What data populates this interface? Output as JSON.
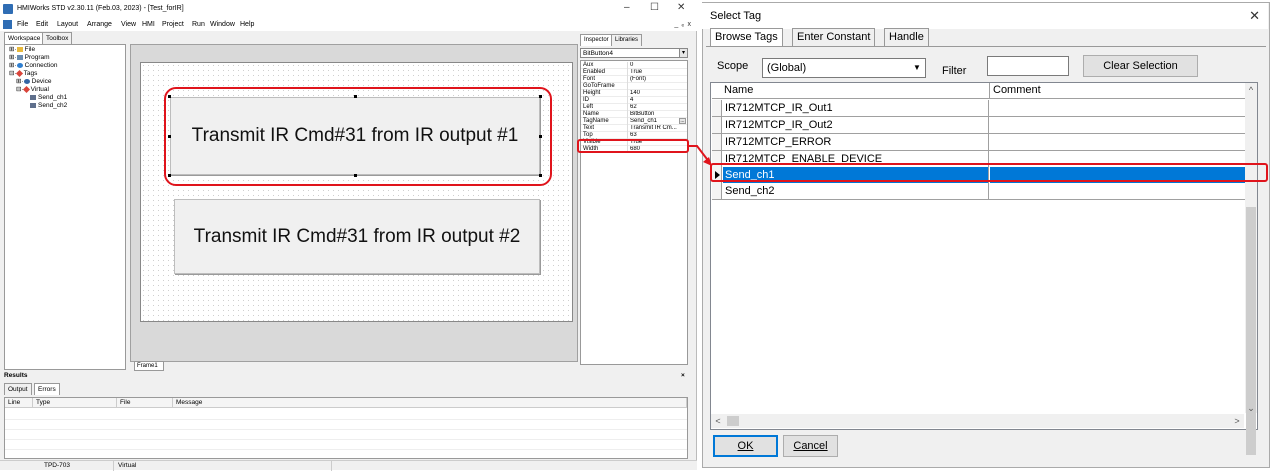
{
  "hmi": {
    "title": "HMIWorks STD v2.30.11 (Feb.03, 2023) - [Test_forIR]",
    "window_controls": [
      "–",
      "☐",
      "✕"
    ],
    "mdi_controls": "_  ₑ  x",
    "menu": [
      "File",
      "Edit",
      "Layout",
      "Arrange",
      "View",
      "HMI",
      "Project",
      "Run",
      "Window",
      "Help"
    ],
    "workspace_tabs": [
      "Workspace",
      "Toolbox"
    ],
    "tree": [
      {
        "label": "File",
        "prefix": "⊞·",
        "icon": "folder-icon",
        "color": "#e8b93c"
      },
      {
        "label": "Program",
        "prefix": "⊞·",
        "icon": "program-icon",
        "color": "#6a8caf"
      },
      {
        "label": "Connection",
        "prefix": "⊞·",
        "icon": "connection-icon",
        "color": "#2f7fd0"
      },
      {
        "label": "Tags",
        "prefix": "⊟·",
        "icon": "tags-icon",
        "color": "#d9443a"
      },
      {
        "label": "Device",
        "prefix": "⊞·",
        "icon": "device-icon",
        "color": "#3465a4"
      },
      {
        "label": "Virtual",
        "prefix": "⊟·",
        "icon": "virtual-icon",
        "color": "#d9443a"
      },
      {
        "label": "Send_ch1",
        "prefix": "",
        "icon": "tag-icon",
        "color": "#5f6f8c"
      },
      {
        "label": "Send_ch2",
        "prefix": "",
        "icon": "tag-icon",
        "color": "#5f6f8c"
      }
    ],
    "buttons": [
      {
        "text": "Transmit IR Cmd#31 from IR output #1"
      },
      {
        "text": "Transmit IR Cmd#31 from IR output #2"
      }
    ],
    "frame_tab": "Frame1",
    "inspector": {
      "tabs": [
        "Inspector",
        "Libraries"
      ],
      "selected_object": "BitButton4",
      "properties": [
        {
          "key": "Aux",
          "value": "0"
        },
        {
          "key": "Enabled",
          "value": "True"
        },
        {
          "key": "Font",
          "value": "(Font)"
        },
        {
          "key": "GoToFrame",
          "value": ""
        },
        {
          "key": "Height",
          "value": "140"
        },
        {
          "key": "ID",
          "value": "4"
        },
        {
          "key": "Left",
          "value": "62"
        },
        {
          "key": "Name",
          "value": "BitButton"
        },
        {
          "key": "TagName",
          "value": "Send_ch1"
        },
        {
          "key": "Text",
          "value": "Transmit IR Cm..."
        },
        {
          "key": "Top",
          "value": "63"
        },
        {
          "key": "Visible",
          "value": "True"
        },
        {
          "key": "Width",
          "value": "680"
        }
      ]
    },
    "results": {
      "title": "Results",
      "close": "×",
      "tabs": [
        "Output",
        "Errors"
      ],
      "columns": [
        "Line",
        "Type",
        "File",
        "Message"
      ]
    },
    "status": [
      "TPD-703",
      "Virtual"
    ]
  },
  "dialog": {
    "title": "Select Tag",
    "close": "✕",
    "tabs": [
      "Browse Tags",
      "Enter Constant",
      "Handle"
    ],
    "scope_label": "Scope",
    "scope_value": "(Global)",
    "filter_label": "Filter",
    "filter_value": "",
    "clear_label": "Clear Selection",
    "columns": [
      "Name",
      "Comment"
    ],
    "rows": [
      {
        "name": "IR712MTCP_IR_Out1",
        "comment": ""
      },
      {
        "name": "IR712MTCP_IR_Out2",
        "comment": ""
      },
      {
        "name": "IR712MTCP_ERROR",
        "comment": ""
      },
      {
        "name": "IR712MTCP_ENABLE_DEVICE",
        "comment": ""
      },
      {
        "name": "Send_ch1",
        "comment": "",
        "selected": true
      },
      {
        "name": "Send_ch2",
        "comment": ""
      }
    ],
    "ok_label": "OK",
    "cancel_label": "Cancel"
  },
  "colors": {
    "highlight": "#e0141c",
    "selection": "#0078d7"
  }
}
